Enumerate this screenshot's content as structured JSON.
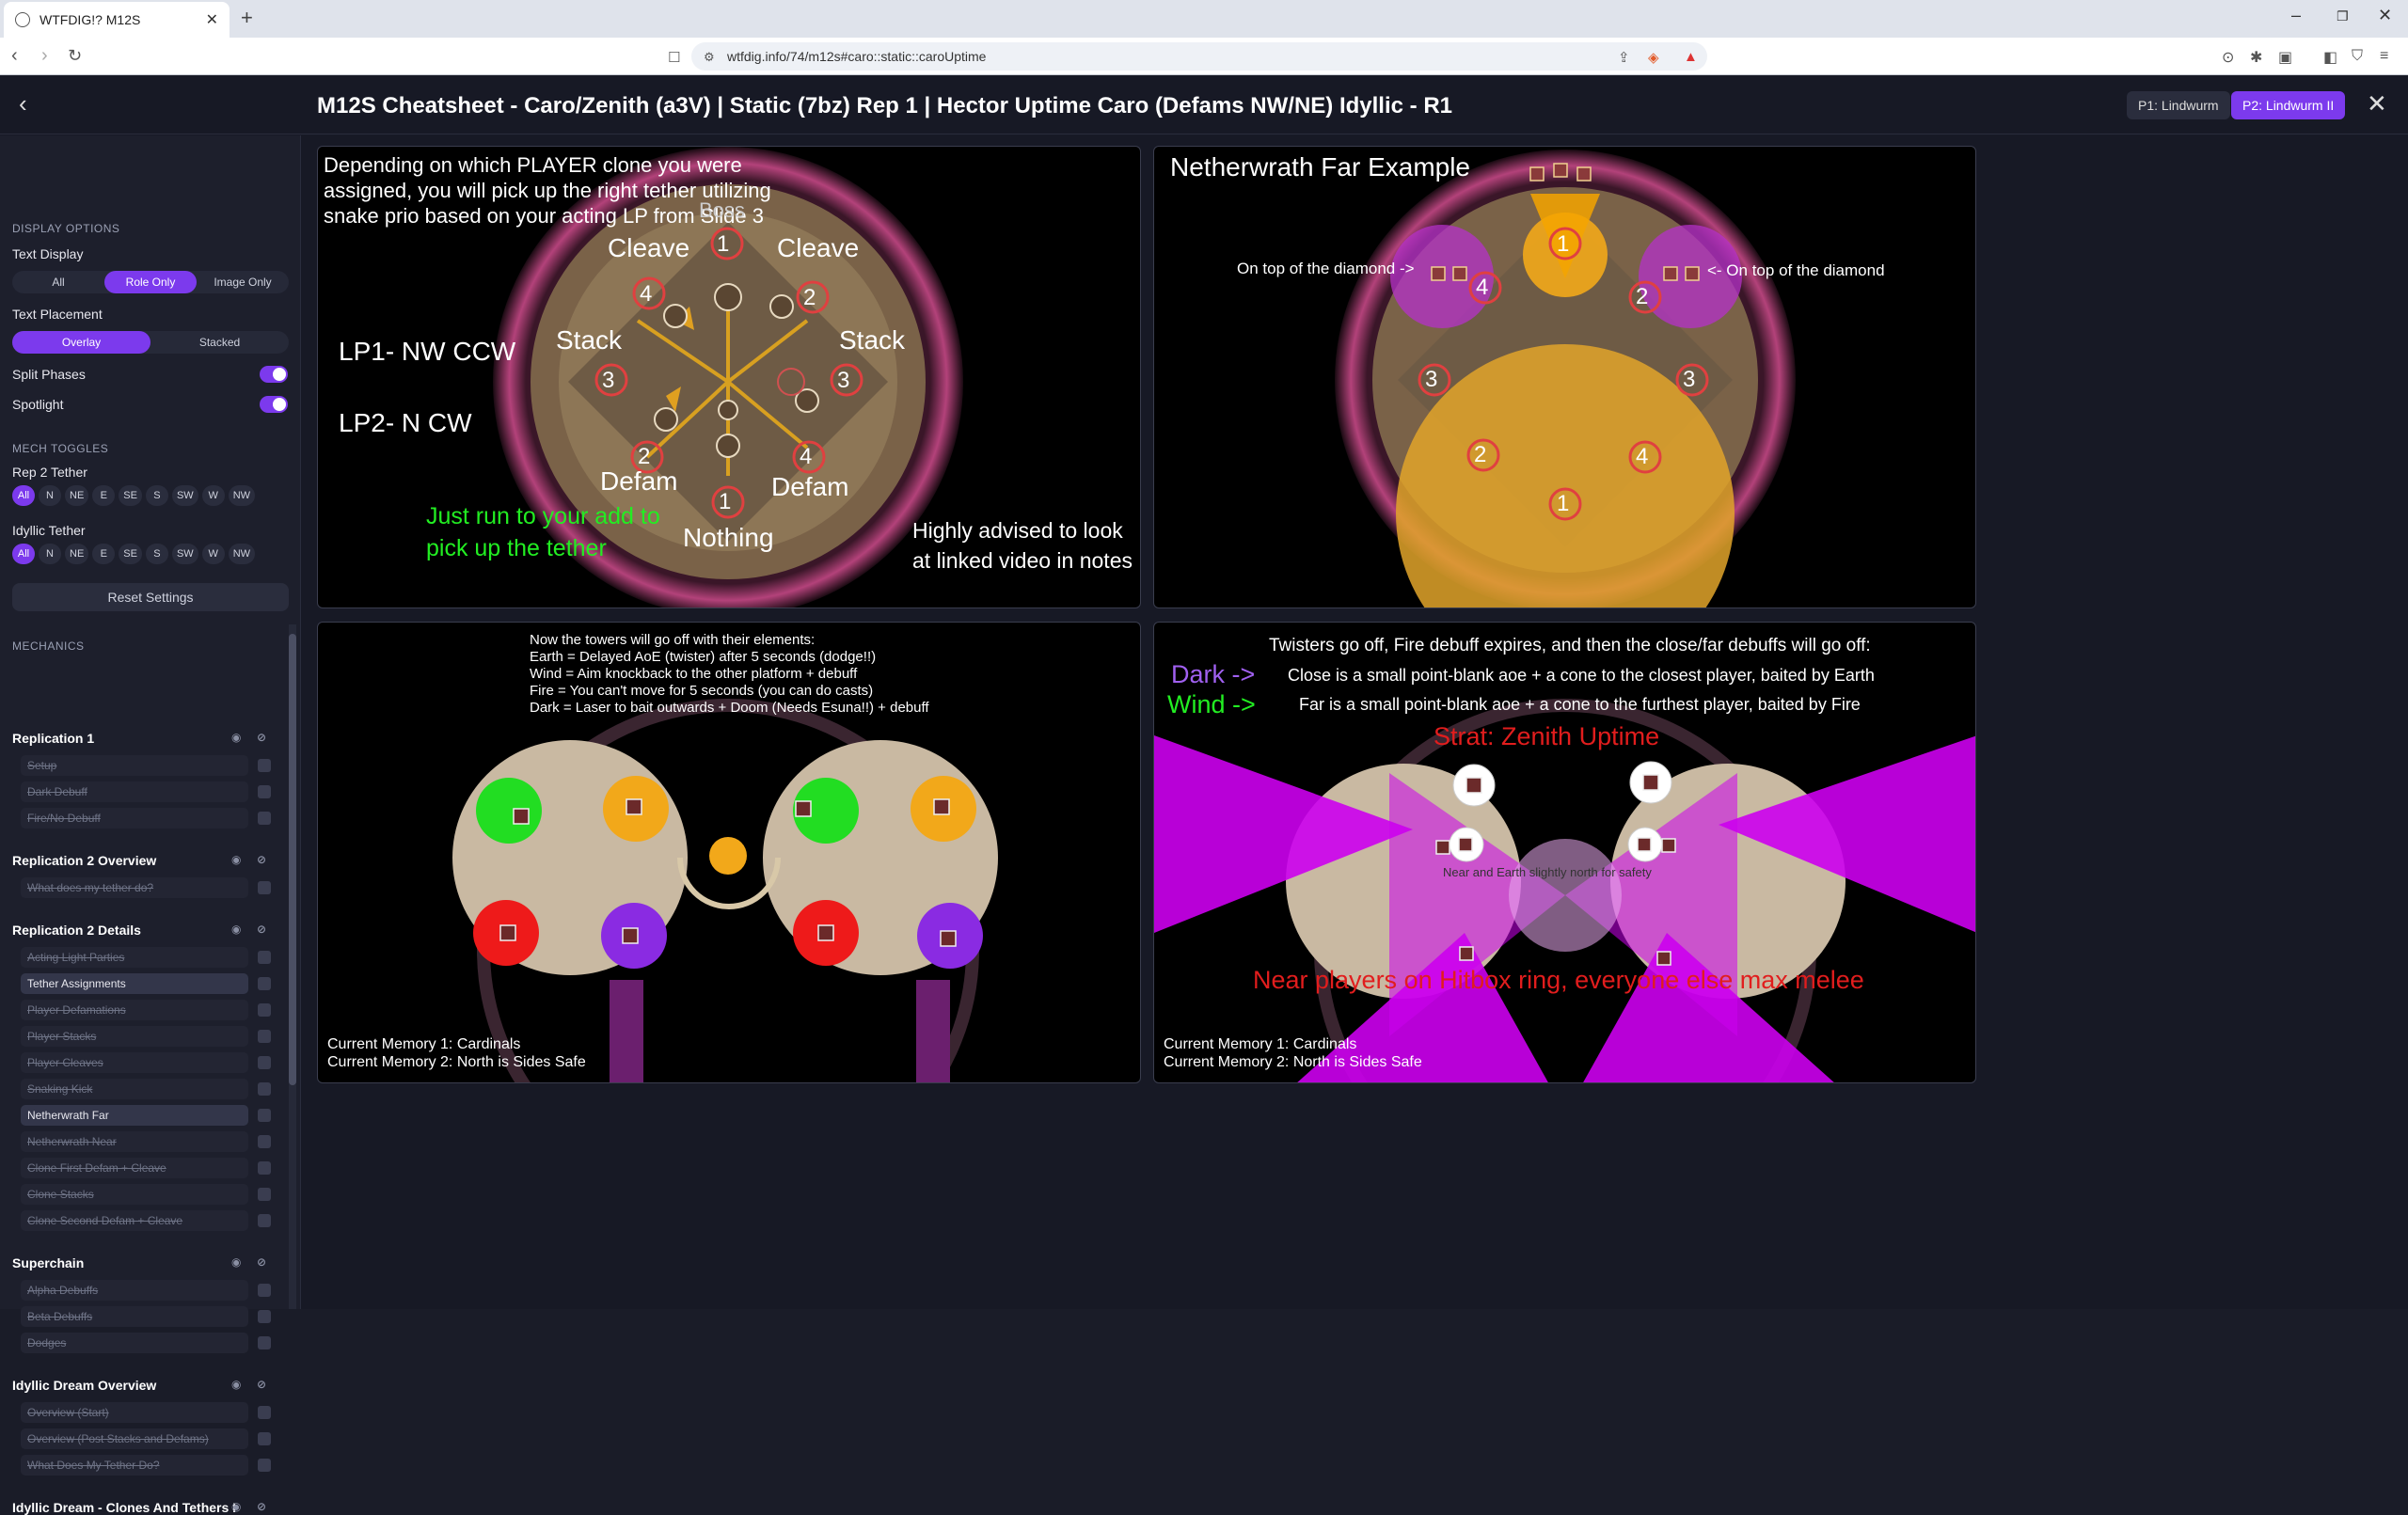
{
  "browser": {
    "tab_title": "WTFDIG!? M12S",
    "url": "wtfdig.info/74/m12s#caro::static::caroUptime"
  },
  "header": {
    "title": "M12S Cheatsheet - Caro/Zenith (a3V) | Static (7bz) Rep 1 | Hector Uptime Caro (Defams NW/NE) Idyllic - R1",
    "phase1": "P1: Lindwurm",
    "phase2": "P2: Lindwurm II"
  },
  "sidebar": {
    "display_options": "DISPLAY OPTIONS",
    "text_display": "Text Display",
    "text_display_opts": [
      "All",
      "Role Only",
      "Image Only"
    ],
    "text_placement": "Text Placement",
    "text_placement_opts": [
      "Overlay",
      "Stacked"
    ],
    "split_phases": "Split Phases",
    "spotlight": "Spotlight",
    "mech_toggles": "MECH TOGGLES",
    "rep2_tether": "Rep 2 Tether",
    "idyllic_tether": "Idyllic Tether",
    "dirs": [
      "All",
      "N",
      "NE",
      "E",
      "SE",
      "S",
      "SW",
      "W",
      "NW"
    ],
    "reset": "Reset Settings",
    "mechanics": "MECHANICS",
    "groups": [
      {
        "title": "Replication 1",
        "items": [
          "Setup",
          "Dark Debuff",
          "Fire/No Debuff"
        ]
      },
      {
        "title": "Replication 2 Overview",
        "items": [
          "What does my tether do?"
        ]
      },
      {
        "title": "Replication 2 Details",
        "items": [
          "Acting Light Parties",
          "Tether Assignments",
          "Player Defamations",
          "Player Stacks",
          "Player Cleaves",
          "Snaking Kick",
          "Netherwrath Far",
          "Netherwrath Near",
          "Clone First Defam + Cleave",
          "Clone Stacks",
          "Clone Second Defam + Cleave"
        ]
      },
      {
        "title": "Superchain",
        "items": [
          "Alpha Debuffs",
          "Beta Debuffs",
          "Dodges"
        ]
      },
      {
        "title": "Idyllic Dream Overview",
        "items": [
          "Overview (Start)",
          "Overview (Post Stacks and Defams)",
          "What Does My Tether Do?"
        ]
      },
      {
        "title": "Idyllic Dream - Clones And Tethers I"
      }
    ]
  },
  "panel1": {
    "intro": "Depending on which PLAYER clone you were assigned, you will pick up the right tether utilizing snake prio based on your acting LP from Slide 3",
    "boss": "Boss",
    "cleave_l": "Cleave",
    "cleave_r": "Cleave",
    "stack_l": "Stack",
    "stack_r": "Stack",
    "defam_l": "Defam",
    "defam_r": "Defam",
    "nothing": "Nothing",
    "lp1": "LP1- NW CCW",
    "lp2": "LP2- N CW",
    "run": "Just run to your add to pick up the tether",
    "advised": "Highly advised to look at linked video in notes",
    "n1": "1",
    "n2": "2",
    "n3": "3",
    "n4": "4"
  },
  "panel2": {
    "title": "Netherwrath Far Example",
    "left_note": "On top of the diamond ->",
    "right_note": "<- On top of the diamond",
    "n1": "1",
    "n2": "2",
    "n3": "3",
    "n4": "4"
  },
  "panel3": {
    "lines": [
      "Now the towers will go off with their elements:",
      "Earth = Delayed AoE (twister) after 5 seconds (dodge!!)",
      "Wind = Aim knockback to the other platform + debuff",
      "Fire = You can't move for 5 seconds (you can do casts)",
      "Dark = Laser to bait outwards + Doom (Needs Esuna!!) + debuff"
    ],
    "mem1": "Current Memory 1: Cardinals",
    "mem2": "Current Memory 2: North is Sides Safe"
  },
  "panel4": {
    "intro": "Twisters go off, Fire debuff expires, and then the close/far debuffs will go off:",
    "dark": "Dark ->",
    "dark_desc": "Close is a small point-blank aoe + a cone to the closest player, baited by Earth",
    "wind": "Wind ->",
    "wind_desc": "Far is a small point-blank aoe + a cone to the furthest player, baited by Fire",
    "strat": "Strat: Zenith Uptime",
    "near": "Near and Earth slightly north for safety",
    "ring": "Near players on Hitbox ring, everyone else max melee",
    "mem1": "Current Memory 1: Cardinals",
    "mem2": "Current Memory 2: North is Sides Safe"
  },
  "colors": {
    "accent": "#7c3aed",
    "green_text": "#22ee22",
    "red_text": "#e11d1d",
    "magenta": "#cc00ee"
  }
}
